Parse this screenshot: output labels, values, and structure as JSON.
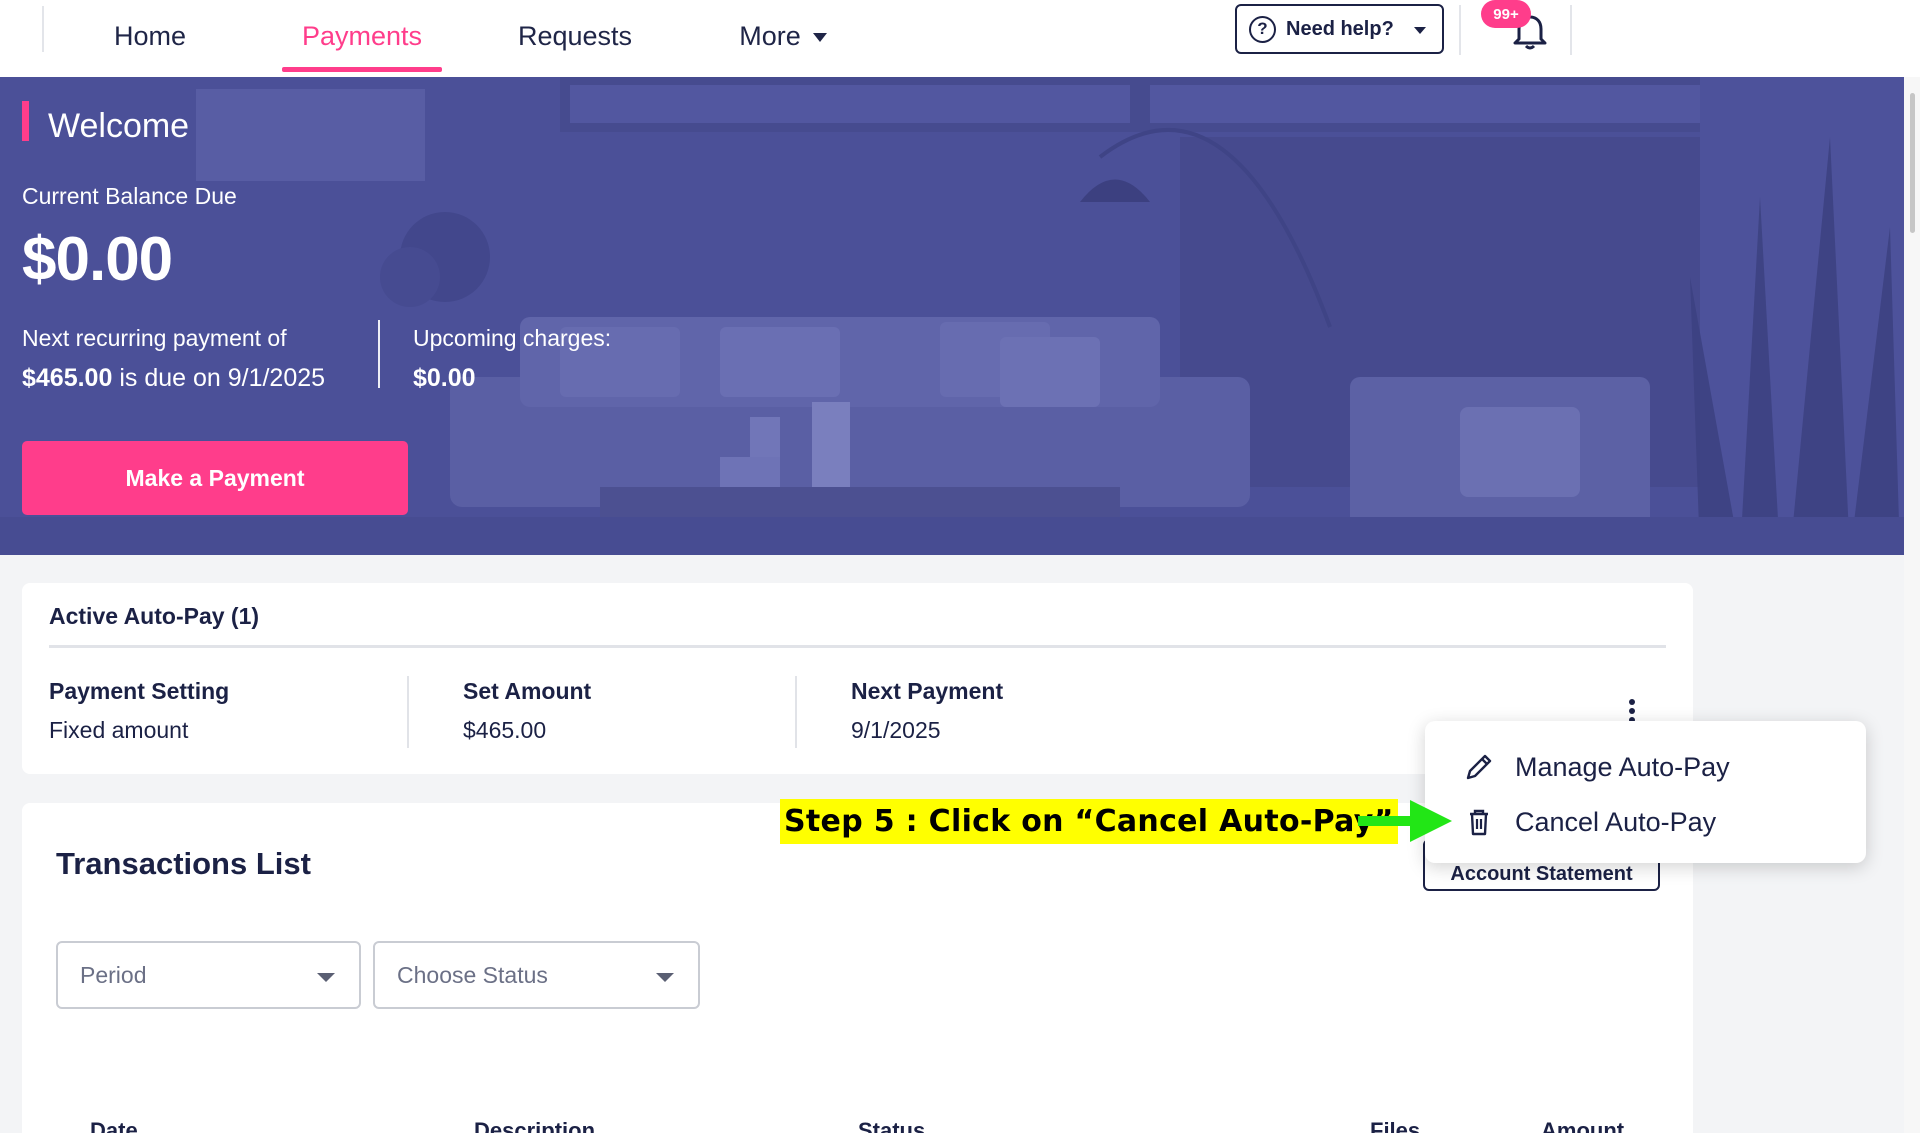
{
  "nav": {
    "home": "Home",
    "payments": "Payments",
    "requests": "Requests",
    "more": "More",
    "help": "Need help?",
    "notification_badge": "99+"
  },
  "hero": {
    "welcome": "Welcome",
    "balance_label": "Current Balance Due",
    "balance_amount": "$0.00",
    "next_label": "Next recurring payment of",
    "next_amount": "$465.00",
    "next_due_text": " is due on 9/1/2025",
    "upcoming_label": "Upcoming charges:",
    "upcoming_amount": "$0.00",
    "pay_button": "Make a Payment"
  },
  "autopay": {
    "title": "Active Auto-Pay (1)",
    "columns": [
      {
        "header": "Payment Setting",
        "value": "Fixed amount"
      },
      {
        "header": "Set Amount",
        "value": "$465.00"
      },
      {
        "header": "Next Payment",
        "value": "9/1/2025"
      }
    ]
  },
  "menu": {
    "manage": "Manage Auto-Pay",
    "cancel": "Cancel Auto-Pay"
  },
  "annotation": {
    "step": "Step 5 : Click on “Cancel Auto-Pay”",
    "arrow_color": "#22e616",
    "highlight_color": "#ffff00"
  },
  "transactions": {
    "title": "Transactions List",
    "statement_button": "Account Statement",
    "period_placeholder": "Period",
    "status_placeholder": "Choose Status",
    "headers": [
      "Date",
      "Description",
      "Status",
      "Files",
      "Amount"
    ]
  },
  "colors": {
    "accent": "#ff3d8b",
    "navy": "#1b2145",
    "hero_overlay": "#4a4f97"
  },
  "icons": [
    "help-circle-icon",
    "bell-icon",
    "pencil-icon",
    "trash-icon",
    "kebab-menu-icon",
    "caret-down-icon",
    "download-icon"
  ]
}
